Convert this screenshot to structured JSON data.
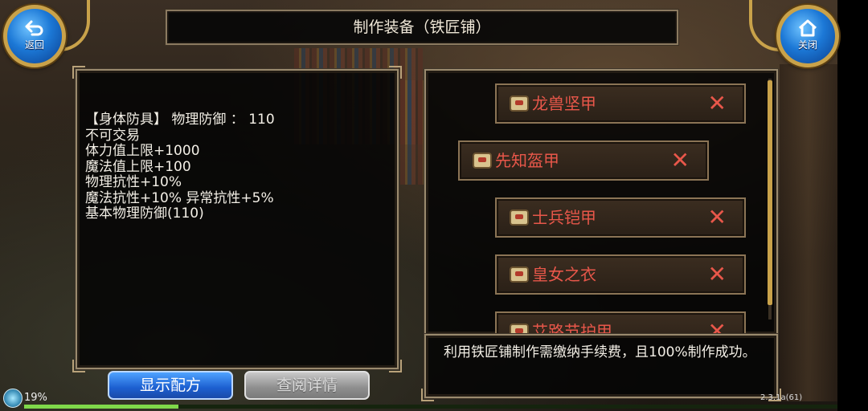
{
  "title": "制作装备（铁匠铺）",
  "back_button": {
    "label": "返回",
    "icon": "back-arrow-icon"
  },
  "close_button": {
    "label": "关闭",
    "icon": "home-icon"
  },
  "info": {
    "lines": [
      "【身体防具】  物理防御 ：  110",
      "不可交易",
      "体力值上限+1000",
      "魔法值上限+100",
      "物理抗性+10%",
      "魔法抗性+10% 异常抗性+5%",
      "基本物理防御(110)"
    ]
  },
  "items": [
    {
      "name": "龙兽坚甲",
      "mark": "✕"
    },
    {
      "name": "先知盔甲",
      "mark": "✕"
    },
    {
      "name": "士兵铠甲",
      "mark": "✕"
    },
    {
      "name": "皇女之衣",
      "mark": "✕"
    },
    {
      "name": "艾路节护甲",
      "mark": "✕"
    }
  ],
  "tip": "利用铁匠铺制作需缴纳手续费，且100%制作成功。",
  "buttons": {
    "show_recipe": "显示配方",
    "view_detail": "查阅详情"
  },
  "status": {
    "progress_label": "19%",
    "progress": 0.19,
    "version": "2.3.1a(61)"
  },
  "colors": {
    "item_text": "#e8574a",
    "button_blue": "#1c5fd0",
    "frame_gold": "#c9a24a"
  }
}
